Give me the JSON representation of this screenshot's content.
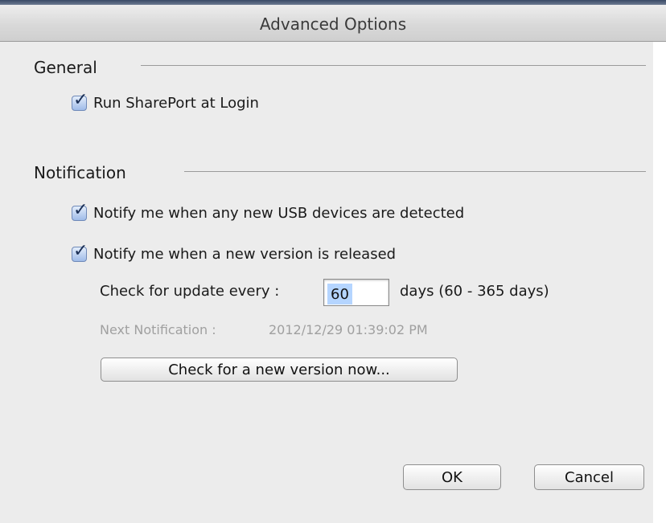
{
  "window": {
    "title": "Advanced Options"
  },
  "general": {
    "heading": "General",
    "run_at_login": {
      "label": "Run SharePort at Login",
      "checked": true
    }
  },
  "notification": {
    "heading": "Notification",
    "usb_detect": {
      "label": "Notify me when any new USB devices are detected",
      "checked": true
    },
    "new_version": {
      "label": "Notify me when a new version is released",
      "checked": true
    },
    "check_every_label": "Check for update every :",
    "days_value": "60",
    "days_range": "days (60 - 365 days)",
    "next_notification_label": "Next Notification :",
    "next_notification_value": "2012/12/29 01:39:02 PM",
    "check_now_button": "Check for a new version now..."
  },
  "buttons": {
    "ok": "OK",
    "cancel": "Cancel"
  },
  "icons": {
    "checkmark": "checkmark-icon"
  },
  "colors": {
    "checkbox_fill": "#9fbbe8",
    "selection": "#b5d5ff"
  }
}
